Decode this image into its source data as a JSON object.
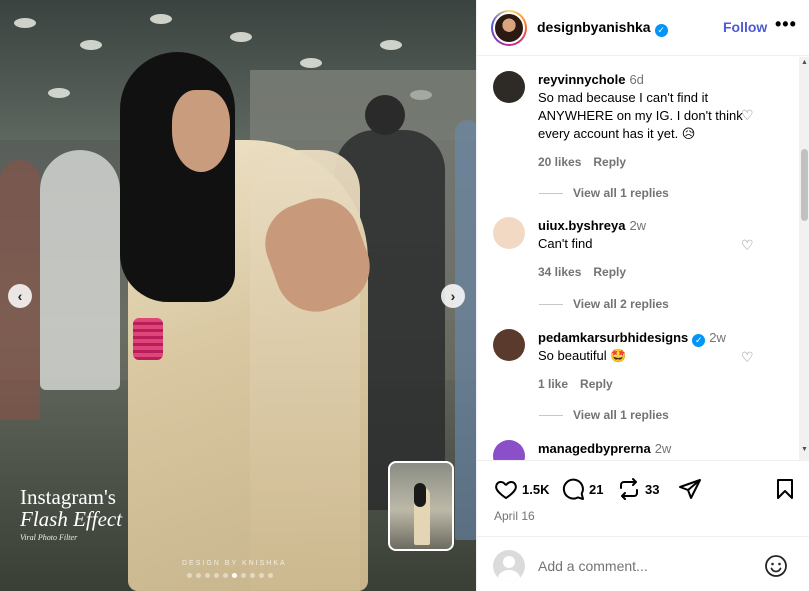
{
  "post": {
    "username": "designbyanishka",
    "verified": true,
    "follow_label": "Follow",
    "more_label": "•••",
    "likes": "1.5K",
    "comments_count": "21",
    "shares_count": "33",
    "date": "April 16",
    "comment_placeholder": "Add a comment...",
    "carousel_index": 6,
    "carousel_total": 10
  },
  "media": {
    "overlay_line1": "Instagram's",
    "overlay_line2": "Flash Effect",
    "overlay_line3": "Viral Photo Filter",
    "watermark": "DESIGN BY KNISHKA",
    "prev_icon": "chevron-left-icon",
    "next_icon": "chevron-right-icon"
  },
  "comments": [
    {
      "user": "reyvinnychole",
      "verified": false,
      "time": "6d",
      "text": "So mad because I can't find it ANYWHERE on my IG. I don't think every account has it yet. 😥",
      "likes": "20 likes",
      "reply": "Reply",
      "view_replies": "View all 1 replies",
      "avatar_color": "#2e2a26"
    },
    {
      "user": "uiux.byshreya",
      "verified": false,
      "time": "2w",
      "text": "Can't find",
      "likes": "34 likes",
      "reply": "Reply",
      "view_replies": "View all 2 replies",
      "avatar_color": "#f2d9c4"
    },
    {
      "user": "pedamkarsurbhidesigns",
      "verified": true,
      "time": "2w",
      "text": "So beautiful 🤩",
      "likes": "1 like",
      "reply": "Reply",
      "view_replies": "View all 1 replies",
      "avatar_color": "#5a3a2c"
    },
    {
      "user": "managedbyprerna",
      "verified": false,
      "time": "2w",
      "avatar_color": "#8a4fc9"
    }
  ],
  "colors": {
    "follow": "#4f5bd5",
    "verified": "#0095f6",
    "muted": "#737373"
  }
}
